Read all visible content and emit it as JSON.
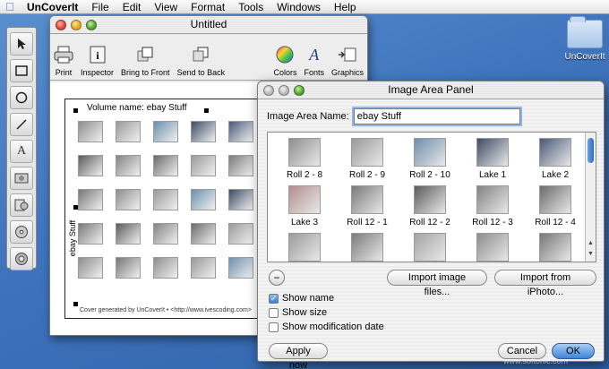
{
  "menubar": {
    "app_name": "UnCoverIt",
    "items": [
      "File",
      "Edit",
      "View",
      "Format",
      "Tools",
      "Windows",
      "Help"
    ]
  },
  "desktop": {
    "icon_label": "UnCoverIt"
  },
  "doc_window": {
    "title": "Untitled",
    "toolbar": [
      "Print",
      "Inspector",
      "Bring to Front",
      "Send to Back",
      "Colors",
      "Fonts",
      "Graphics"
    ],
    "volume_label": "Volume name: ebay Stuff",
    "side_label": "ebay Stuff",
    "footer": "Cover generated by UnCoverIt • <http://www.ivescoding.com>"
  },
  "panel": {
    "title": "Image Area Panel",
    "name_label": "Image Area Name:",
    "name_value": "ebay Stuff",
    "images": [
      {
        "caption": "Roll 2 - 8",
        "color": "#8e8e8e"
      },
      {
        "caption": "Roll 2 - 9",
        "color": "#9a9a9a"
      },
      {
        "caption": "Roll 2 - 10",
        "color": "#6e8fae"
      },
      {
        "caption": "Lake 1",
        "color": "#3e4c66"
      },
      {
        "caption": "Lake 2",
        "color": "#4b5a7a"
      },
      {
        "caption": "Lake 3",
        "color": "#b48e8e"
      },
      {
        "caption": "Roll 12 - 1",
        "color": "#7a7a7a"
      },
      {
        "caption": "Roll 12 - 2",
        "color": "#5c5c5c"
      },
      {
        "caption": "Roll 12 - 3",
        "color": "#848484"
      },
      {
        "caption": "Roll 12 - 4",
        "color": "#6b6b6b"
      },
      {
        "caption": "",
        "color": "#9b9b9b"
      },
      {
        "caption": "",
        "color": "#7c7c7c"
      },
      {
        "caption": "",
        "color": "#a4a4a4"
      },
      {
        "caption": "",
        "color": "#8d8d8d"
      },
      {
        "caption": "",
        "color": "#777777"
      }
    ],
    "import_files_label": "Import image files...",
    "import_iphoto_label": "Import from iPhoto...",
    "options": [
      {
        "label": "Show name",
        "checked": true
      },
      {
        "label": "Show size",
        "checked": false
      },
      {
        "label": "Show modification date",
        "checked": false
      }
    ],
    "apply_label": "Apply now",
    "cancel_label": "Cancel",
    "ok_label": "OK"
  },
  "watermark": "www.softonic.com"
}
